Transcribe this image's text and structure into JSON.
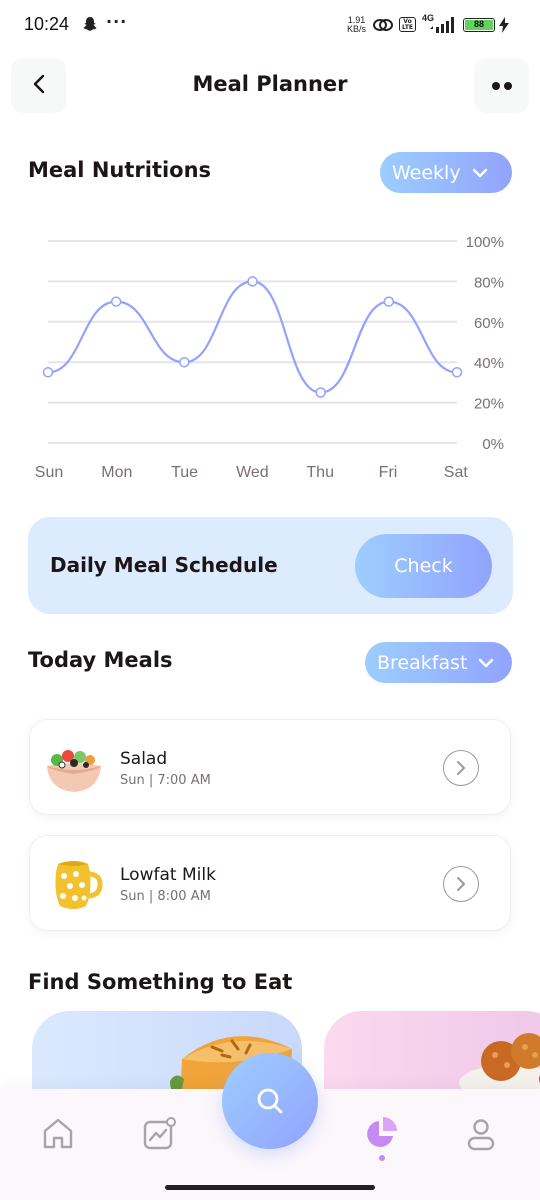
{
  "status_bar": {
    "time": "10:24",
    "speed_value": "1.91",
    "speed_unit": "KB/s",
    "network": "4G",
    "volte": "Vo LTE",
    "battery": "88"
  },
  "header": {
    "title": "Meal Planner",
    "back_icon": "chevron-left-icon",
    "more_icon": "two-dots-icon"
  },
  "nutrition": {
    "title": "Meal Nutritions",
    "period_selector": "Weekly"
  },
  "chart_data": {
    "type": "line",
    "categories": [
      "Sun",
      "Mon",
      "Tue",
      "Wed",
      "Thu",
      "Fri",
      "Sat"
    ],
    "values": [
      35,
      70,
      40,
      80,
      25,
      70,
      35
    ],
    "y_ticks": [
      "100%",
      "80%",
      "60%",
      "40%",
      "20%",
      "0%"
    ],
    "ylim": [
      0,
      100
    ],
    "grid": true,
    "line_color": "#92a3fd",
    "title": "",
    "xlabel": "",
    "ylabel": ""
  },
  "schedule": {
    "label": "Daily Meal Schedule",
    "button": "Check"
  },
  "today_meals": {
    "title": "Today Meals",
    "selector": "Breakfast",
    "items": [
      {
        "name": "Salad",
        "time": "Sun | 7:00 AM",
        "icon": "salad-bowl-icon"
      },
      {
        "name": "Lowfat Milk",
        "time": "Sun | 8:00 AM",
        "icon": "milk-jug-icon"
      }
    ]
  },
  "find": {
    "title": "Find Something to Eat",
    "cards": [
      {
        "icon": "pie-icon"
      },
      {
        "icon": "pancakes-icon"
      }
    ]
  },
  "bottom_nav": {
    "items": [
      "home-icon",
      "activity-icon",
      "search-icon",
      "pie-chart-icon",
      "profile-icon"
    ],
    "active": "pie-chart-icon",
    "accent": "#c58bf2"
  },
  "colors": {
    "primary_gradient_start": "#9dceff",
    "primary_gradient_end": "#92a3fd",
    "text_dark": "#1d1617",
    "text_gray": "#7b6f72"
  }
}
